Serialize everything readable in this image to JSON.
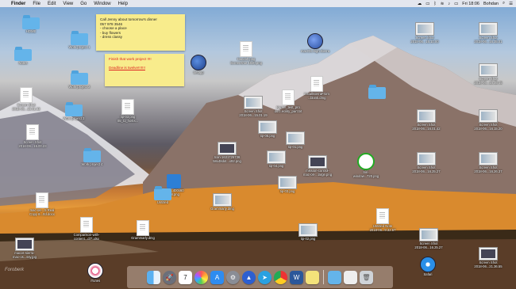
{
  "menubar": {
    "apple": "",
    "items": [
      "Finder",
      "File",
      "Edit",
      "View",
      "Go",
      "Window",
      "Help"
    ],
    "clock": "Fri 18:06",
    "user": "Bohdan"
  },
  "stickies": [
    {
      "lines": [
        "Call Jenny about tomorrow's dinner",
        "057 978 3546",
        "- choose a place",
        "- buy flowers",
        "- dress classy"
      ]
    },
    {
      "lines": [
        "Finish that work project !!!!",
        "",
        "Deadline is twelve!!!!!!!"
      ]
    }
  ],
  "icons": {
    "home": "HOME",
    "work_project_1": "Work project 1",
    "notes": "Notes",
    "work_project_2": "Work project 2",
    "screen_shot_1": "Screen Shot\n2018-06...15.01.32",
    "work_project_3": "Work project 3",
    "file_mid_1": "tip-03.png\n05_t1_hosts...",
    "work_project_4": "Work project 4",
    "doc_pdf": "Screen Shot\n2018-06...15.00.23",
    "hermes": "Setapp",
    "handoff": "Handoff.png\nScreenshot 1020.png",
    "setapp_icon": "Setapp",
    "finder_disk": "macOS.High.Sierra",
    "txt_file": "Screen Shot\n2018-06...15.01.19",
    "sierra_ist": "installSierraFrom\n...blank.dmg",
    "blue_folder": "",
    "kernel_file": "Kernel_test_pro\nduct.ecility_part.txt",
    "tip_05": "tip-05.png",
    "tip_01": "tip-01.png",
    "tip_04": "tip-04.png",
    "icon_tiff": "Icon-1631725736\n58x48dot...x92.png",
    "bit_png": "384x_400x60\n...8.png",
    "untitled": "Untitled",
    "mission_ctrl": "mission-control-\nmac-os-...large.png",
    "tip_03": "tip-03.png",
    "siri_png": "Siri-\nwindow...720.png",
    "tips_03": "Grammarly.dmg",
    "cmp_text": "Comparison-with-\ncontent...d7*.xlsx",
    "pdf_doc": "mac-os-...5 Real\nCopy 6...rtd.docx",
    "grammarly": "Grammarly.dmg",
    "tip_02": "tip-02.png",
    "untitled_note": "Untitled Note\n2018-06...9.32.57",
    "screen_shot_2": "Screen Shot\n2018-06...16.25.27",
    "screen_shot_3": "Screen Shot\n2018-06...16.26.37",
    "screen_shot_4": "Screen Shot\n2018-06...16.01.42",
    "screen_shot_5": "Screen Shot\n2018-06...16.15.20",
    "screen_shot_6": "Screen Shot\n2018-06...16.35.01",
    "screen_shot_7": "Screen Shot\n2018-06...16.35.45",
    "screen_shot_8": "Screen Shot\n2018-06...21.36.55",
    "itunes": "iTunes",
    "safari": "Safari",
    "desktop_mac": "Screen Shot\n2018-06...16.10.00",
    "mac_jpg": "macos-sierra-\nmac-os...ssy.jpg"
  },
  "watermark": "Foroberk"
}
